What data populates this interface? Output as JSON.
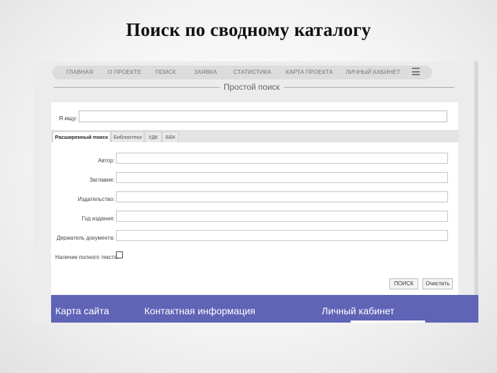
{
  "slide": {
    "title": "Поиск по сводному каталогу"
  },
  "nav": {
    "items": [
      "ГЛАВНАЯ",
      "О ПРОЕКТЕ",
      "ПОИСК",
      "ЗАЯВКА",
      "СТАТИСТИКА",
      "КАРТА ПРОЕКТА",
      "ЛИЧНЫЙ КАБИНЕТ"
    ],
    "menu_icon": "hamburger-menu-icon"
  },
  "simple_search": {
    "heading": "Простой поиск",
    "query_label": "Я ищу:",
    "query_value": ""
  },
  "tabs": [
    "Расширенный поиск",
    "Библиотеки",
    "УДК",
    "ББК"
  ],
  "advanced_form": {
    "fields": [
      {
        "label": "Автор:",
        "value": ""
      },
      {
        "label": "Заглавие:",
        "value": ""
      },
      {
        "label": "Издательство:",
        "value": ""
      },
      {
        "label": "Год издания:",
        "value": ""
      },
      {
        "label": "Держатель документа:",
        "value": ""
      }
    ],
    "fulltext_label": "Наличие полного текста:",
    "search_button": "ПОИСК",
    "clear_button": "Очистить"
  },
  "footer": {
    "items": [
      "Карта сайта",
      "Контактная информация",
      "Личный кабинет"
    ]
  },
  "colors": {
    "footer_bg": "#5f64b6",
    "page_bg": "#ececec"
  }
}
